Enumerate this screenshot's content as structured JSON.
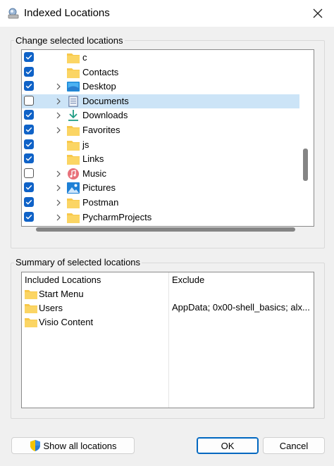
{
  "window": {
    "title": "Indexed Locations"
  },
  "change_group": {
    "label": "Change selected locations"
  },
  "tree_items": [
    {
      "label": "c",
      "checked": true,
      "expandable": false,
      "icon": "folder-icon",
      "selected": false
    },
    {
      "label": "Contacts",
      "checked": true,
      "expandable": false,
      "icon": "folder-icon",
      "selected": false
    },
    {
      "label": "Desktop",
      "checked": true,
      "expandable": true,
      "icon": "desktop-icon",
      "selected": false
    },
    {
      "label": "Documents",
      "checked": false,
      "expandable": true,
      "icon": "documents-icon",
      "selected": true
    },
    {
      "label": "Downloads",
      "checked": true,
      "expandable": true,
      "icon": "downloads-icon",
      "selected": false
    },
    {
      "label": "Favorites",
      "checked": true,
      "expandable": true,
      "icon": "folder-icon",
      "selected": false
    },
    {
      "label": "js",
      "checked": true,
      "expandable": false,
      "icon": "folder-icon",
      "selected": false
    },
    {
      "label": "Links",
      "checked": true,
      "expandable": false,
      "icon": "folder-icon",
      "selected": false
    },
    {
      "label": "Music",
      "checked": false,
      "expandable": true,
      "icon": "music-icon",
      "selected": false
    },
    {
      "label": "Pictures",
      "checked": true,
      "expandable": true,
      "icon": "pictures-icon",
      "selected": false
    },
    {
      "label": "Postman",
      "checked": true,
      "expandable": true,
      "icon": "folder-icon",
      "selected": false
    },
    {
      "label": "PycharmProjects",
      "checked": true,
      "expandable": true,
      "icon": "folder-icon",
      "selected": false
    }
  ],
  "summary_group": {
    "label": "Summary of selected locations"
  },
  "summary": {
    "col_included": "Included Locations",
    "col_exclude": "Exclude",
    "included": [
      "Start Menu",
      "Users",
      "Visio Content"
    ],
    "exclude_text": "AppData; 0x00-shell_basics; alx..."
  },
  "buttons": {
    "show_all": "Show all locations",
    "ok": "OK",
    "cancel": "Cancel"
  },
  "colors": {
    "checkbox": "#0f62c7",
    "selection": "#cce4f7",
    "folder": "#f8c84a",
    "accent": "#0067c0"
  }
}
